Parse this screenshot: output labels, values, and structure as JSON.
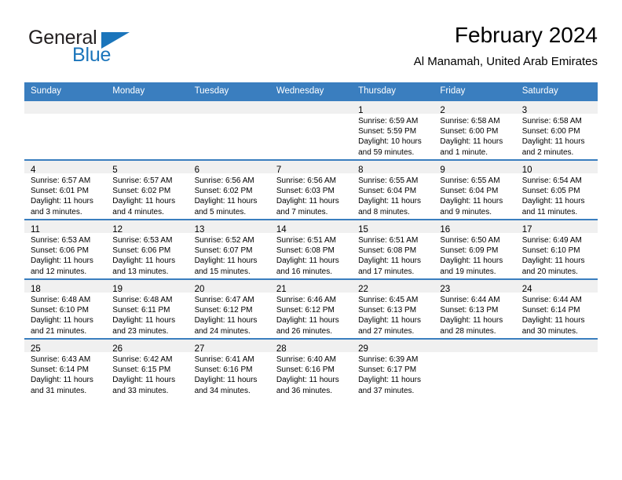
{
  "brand": {
    "name_part1": "General",
    "name_part2": "Blue",
    "accent_color": "#1b75bb"
  },
  "header": {
    "title": "February 2024",
    "subtitle": "Al Manamah, United Arab Emirates"
  },
  "theme": {
    "header_row_bg": "#3a7ebf",
    "daynum_band_bg": "#f0f0f0",
    "row_border": "#3a7ebf"
  },
  "weekdays": [
    "Sunday",
    "Monday",
    "Tuesday",
    "Wednesday",
    "Thursday",
    "Friday",
    "Saturday"
  ],
  "weeks": [
    [
      {
        "day": "",
        "lines": []
      },
      {
        "day": "",
        "lines": []
      },
      {
        "day": "",
        "lines": []
      },
      {
        "day": "",
        "lines": []
      },
      {
        "day": "1",
        "lines": [
          "Sunrise: 6:59 AM",
          "Sunset: 5:59 PM",
          "Daylight: 10 hours",
          "and 59 minutes."
        ]
      },
      {
        "day": "2",
        "lines": [
          "Sunrise: 6:58 AM",
          "Sunset: 6:00 PM",
          "Daylight: 11 hours",
          "and 1 minute."
        ]
      },
      {
        "day": "3",
        "lines": [
          "Sunrise: 6:58 AM",
          "Sunset: 6:00 PM",
          "Daylight: 11 hours",
          "and 2 minutes."
        ]
      }
    ],
    [
      {
        "day": "4",
        "lines": [
          "Sunrise: 6:57 AM",
          "Sunset: 6:01 PM",
          "Daylight: 11 hours",
          "and 3 minutes."
        ]
      },
      {
        "day": "5",
        "lines": [
          "Sunrise: 6:57 AM",
          "Sunset: 6:02 PM",
          "Daylight: 11 hours",
          "and 4 minutes."
        ]
      },
      {
        "day": "6",
        "lines": [
          "Sunrise: 6:56 AM",
          "Sunset: 6:02 PM",
          "Daylight: 11 hours",
          "and 5 minutes."
        ]
      },
      {
        "day": "7",
        "lines": [
          "Sunrise: 6:56 AM",
          "Sunset: 6:03 PM",
          "Daylight: 11 hours",
          "and 7 minutes."
        ]
      },
      {
        "day": "8",
        "lines": [
          "Sunrise: 6:55 AM",
          "Sunset: 6:04 PM",
          "Daylight: 11 hours",
          "and 8 minutes."
        ]
      },
      {
        "day": "9",
        "lines": [
          "Sunrise: 6:55 AM",
          "Sunset: 6:04 PM",
          "Daylight: 11 hours",
          "and 9 minutes."
        ]
      },
      {
        "day": "10",
        "lines": [
          "Sunrise: 6:54 AM",
          "Sunset: 6:05 PM",
          "Daylight: 11 hours",
          "and 11 minutes."
        ]
      }
    ],
    [
      {
        "day": "11",
        "lines": [
          "Sunrise: 6:53 AM",
          "Sunset: 6:06 PM",
          "Daylight: 11 hours",
          "and 12 minutes."
        ]
      },
      {
        "day": "12",
        "lines": [
          "Sunrise: 6:53 AM",
          "Sunset: 6:06 PM",
          "Daylight: 11 hours",
          "and 13 minutes."
        ]
      },
      {
        "day": "13",
        "lines": [
          "Sunrise: 6:52 AM",
          "Sunset: 6:07 PM",
          "Daylight: 11 hours",
          "and 15 minutes."
        ]
      },
      {
        "day": "14",
        "lines": [
          "Sunrise: 6:51 AM",
          "Sunset: 6:08 PM",
          "Daylight: 11 hours",
          "and 16 minutes."
        ]
      },
      {
        "day": "15",
        "lines": [
          "Sunrise: 6:51 AM",
          "Sunset: 6:08 PM",
          "Daylight: 11 hours",
          "and 17 minutes."
        ]
      },
      {
        "day": "16",
        "lines": [
          "Sunrise: 6:50 AM",
          "Sunset: 6:09 PM",
          "Daylight: 11 hours",
          "and 19 minutes."
        ]
      },
      {
        "day": "17",
        "lines": [
          "Sunrise: 6:49 AM",
          "Sunset: 6:10 PM",
          "Daylight: 11 hours",
          "and 20 minutes."
        ]
      }
    ],
    [
      {
        "day": "18",
        "lines": [
          "Sunrise: 6:48 AM",
          "Sunset: 6:10 PM",
          "Daylight: 11 hours",
          "and 21 minutes."
        ]
      },
      {
        "day": "19",
        "lines": [
          "Sunrise: 6:48 AM",
          "Sunset: 6:11 PM",
          "Daylight: 11 hours",
          "and 23 minutes."
        ]
      },
      {
        "day": "20",
        "lines": [
          "Sunrise: 6:47 AM",
          "Sunset: 6:12 PM",
          "Daylight: 11 hours",
          "and 24 minutes."
        ]
      },
      {
        "day": "21",
        "lines": [
          "Sunrise: 6:46 AM",
          "Sunset: 6:12 PM",
          "Daylight: 11 hours",
          "and 26 minutes."
        ]
      },
      {
        "day": "22",
        "lines": [
          "Sunrise: 6:45 AM",
          "Sunset: 6:13 PM",
          "Daylight: 11 hours",
          "and 27 minutes."
        ]
      },
      {
        "day": "23",
        "lines": [
          "Sunrise: 6:44 AM",
          "Sunset: 6:13 PM",
          "Daylight: 11 hours",
          "and 28 minutes."
        ]
      },
      {
        "day": "24",
        "lines": [
          "Sunrise: 6:44 AM",
          "Sunset: 6:14 PM",
          "Daylight: 11 hours",
          "and 30 minutes."
        ]
      }
    ],
    [
      {
        "day": "25",
        "lines": [
          "Sunrise: 6:43 AM",
          "Sunset: 6:14 PM",
          "Daylight: 11 hours",
          "and 31 minutes."
        ]
      },
      {
        "day": "26",
        "lines": [
          "Sunrise: 6:42 AM",
          "Sunset: 6:15 PM",
          "Daylight: 11 hours",
          "and 33 minutes."
        ]
      },
      {
        "day": "27",
        "lines": [
          "Sunrise: 6:41 AM",
          "Sunset: 6:16 PM",
          "Daylight: 11 hours",
          "and 34 minutes."
        ]
      },
      {
        "day": "28",
        "lines": [
          "Sunrise: 6:40 AM",
          "Sunset: 6:16 PM",
          "Daylight: 11 hours",
          "and 36 minutes."
        ]
      },
      {
        "day": "29",
        "lines": [
          "Sunrise: 6:39 AM",
          "Sunset: 6:17 PM",
          "Daylight: 11 hours",
          "and 37 minutes."
        ]
      },
      {
        "day": "",
        "lines": []
      },
      {
        "day": "",
        "lines": []
      }
    ]
  ]
}
